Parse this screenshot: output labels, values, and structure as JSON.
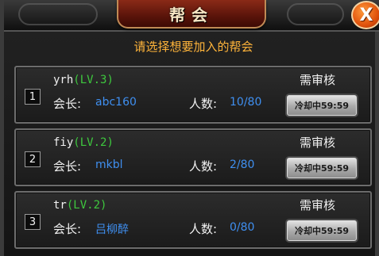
{
  "dialog": {
    "title": "帮会",
    "close_icon": "X",
    "instruction": "请选择想要加入的帮会"
  },
  "labels": {
    "leader": "会长:",
    "members": "人数:"
  },
  "guilds": [
    {
      "index": "1",
      "name": "yrh",
      "level": "(LV.3)",
      "leader": "abc160",
      "members": "10/80",
      "status": "需审核",
      "button": "冷却中59:59"
    },
    {
      "index": "2",
      "name": "fiy",
      "level": "(LV.2)",
      "leader": "mkbl",
      "members": "2/80",
      "status": "需审核",
      "button": "冷却中59:59"
    },
    {
      "index": "3",
      "name": "tr",
      "level": "(LV.2)",
      "leader": "吕柳醉",
      "members": "0/80",
      "status": "需审核",
      "button": "冷却中59:59"
    }
  ],
  "colors": {
    "instruction": "#ffb43a",
    "level": "#3ec83e",
    "value": "#3f8ff0",
    "title_plate": "#6a1a0c",
    "close_button": "#e0520c"
  }
}
